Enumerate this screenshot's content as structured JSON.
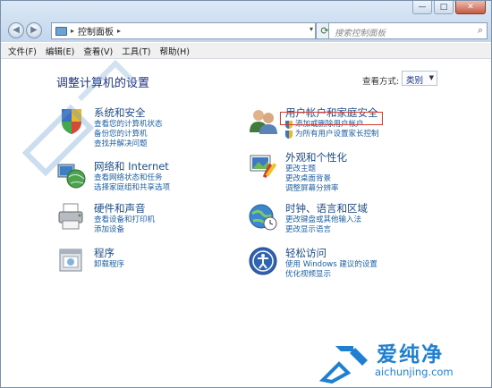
{
  "window": {
    "controls": [
      "—",
      "□",
      "✕"
    ]
  },
  "address": {
    "nav_back": "◀",
    "nav_forward": "▶",
    "separator": "▸",
    "path": "控制面板",
    "separator_after": "▸",
    "refresh_glyph": "⟳",
    "search_placeholder": "搜索控制面板"
  },
  "menubar": {
    "items": [
      "文件(F)",
      "编辑(E)",
      "查看(V)",
      "工具(T)",
      "帮助(H)"
    ]
  },
  "content": {
    "title": "调整计算机的设置",
    "view_by_label": "查看方式:",
    "view_by_value": "类别"
  },
  "categories": [
    {
      "title": "系统和安全",
      "links": [
        "查看您的计算机状态",
        "备份您的计算机",
        "查找并解决问题"
      ]
    },
    {
      "title": "网络和 Internet",
      "links": [
        "查看网络状态和任务",
        "选择家庭组和共享选项"
      ]
    },
    {
      "title": "硬件和声音",
      "links": [
        "查看设备和打印机",
        "添加设备"
      ]
    },
    {
      "title": "程序",
      "links": [
        "卸载程序"
      ]
    },
    {
      "title": "用户帐户和家庭安全",
      "links": [
        "添加或删除用户帐户",
        "为所有用户设置家长控制"
      ]
    },
    {
      "title": "外观和个性化",
      "links": [
        "更改主题",
        "更改桌面背景",
        "调整屏幕分辨率"
      ]
    },
    {
      "title": "时钟、语言和区域",
      "links": [
        "更改键盘或其他输入法",
        "更改显示语言"
      ]
    },
    {
      "title": "轻松访问",
      "links": [
        "使用 Windows 建议的设置",
        "优化视频显示"
      ]
    }
  ],
  "watermark": {
    "brand_cn": "爱纯净",
    "url": "aichunjing.com"
  },
  "colors": {
    "link": "#1e5fa8",
    "title": "#1e3287",
    "highlight": "#d63c2f",
    "watermark": "#1f7fd0"
  }
}
